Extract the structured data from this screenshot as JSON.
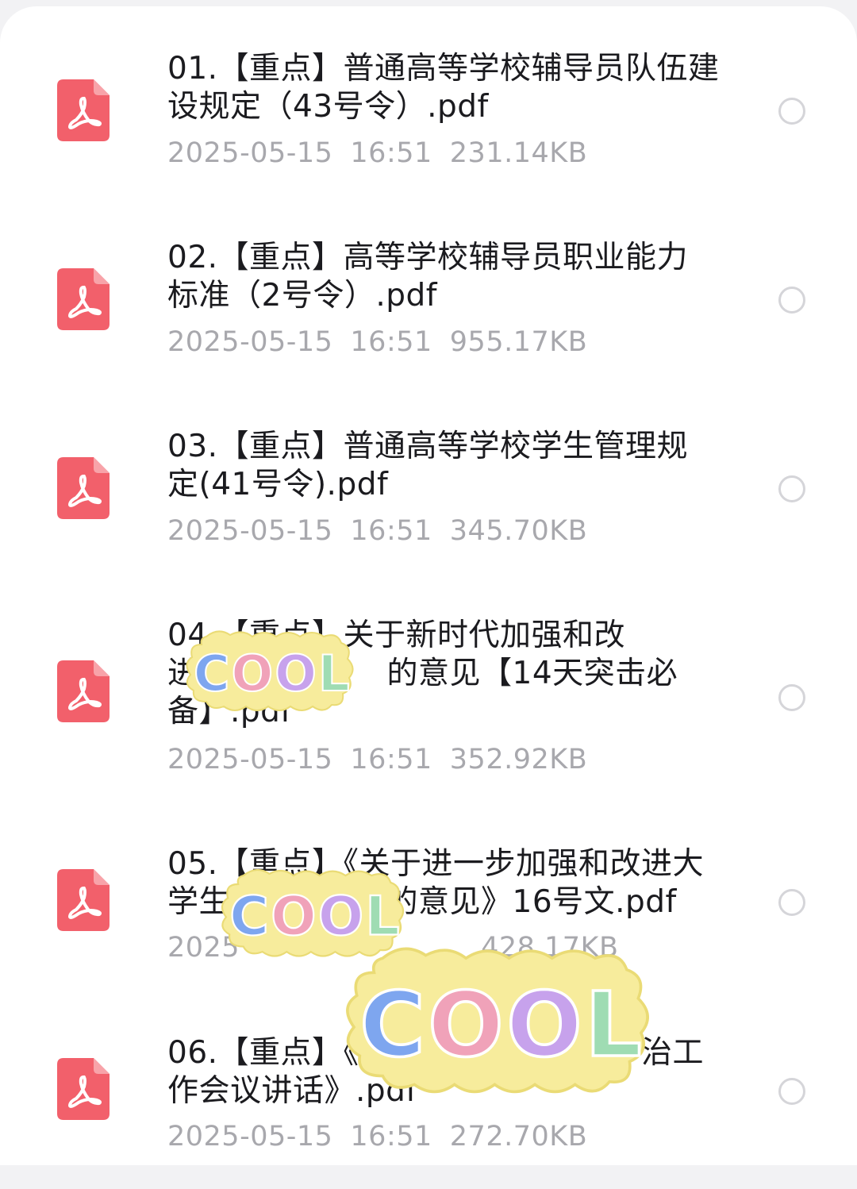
{
  "files": [
    {
      "name": "01.【重点】普通高等学校辅导员队伍建\n设规定（43号令）.pdf",
      "date": "2025-05-15",
      "time": "16:51",
      "size": "231.14KB"
    },
    {
      "name": "02.【重点】高等学校辅导员职业能力\n标准（2号令）.pdf",
      "date": "2025-05-15",
      "time": "16:51",
      "size": "955.17KB"
    },
    {
      "name": "03.【重点】普通高等学校学生管理规\n定(41号令).pdf",
      "date": "2025-05-15",
      "time": "16:51",
      "size": "345.70KB"
    },
    {
      "name": "04.【重点】关于新时代加强和改\n进　　　　　　的意见【14天突击必\n备】.pdf",
      "date": "2025-05-15",
      "time": "16:51",
      "size": "352.92KB"
    },
    {
      "name": "05.【重点】《关于进一步加强和改进大\n学生　　　　　的意见》16号文.pdf",
      "date": "2025",
      "time": "",
      "size": "428.17KB"
    },
    {
      "name": "06.【重点】《　　　　　　　　　治工\n作会议讲话》.pdf",
      "date": "2025-05-15",
      "time": "16:51",
      "size": "272.70KB"
    }
  ],
  "icons": {
    "file": "pdf-file-icon",
    "select": "radio-circle-icon"
  },
  "sticker_text": "COOL",
  "colors": {
    "pdf_icon": "#f2606b",
    "name_text": "#1b1b1f",
    "meta_text": "#a8a8ad",
    "radio_border": "#d5d5d9",
    "sticker_blob": "#f7ec9c",
    "sticker_letters": [
      "#7ea6ef",
      "#f0a2b9",
      "#c7a2ec",
      "#9fdcb3"
    ]
  }
}
